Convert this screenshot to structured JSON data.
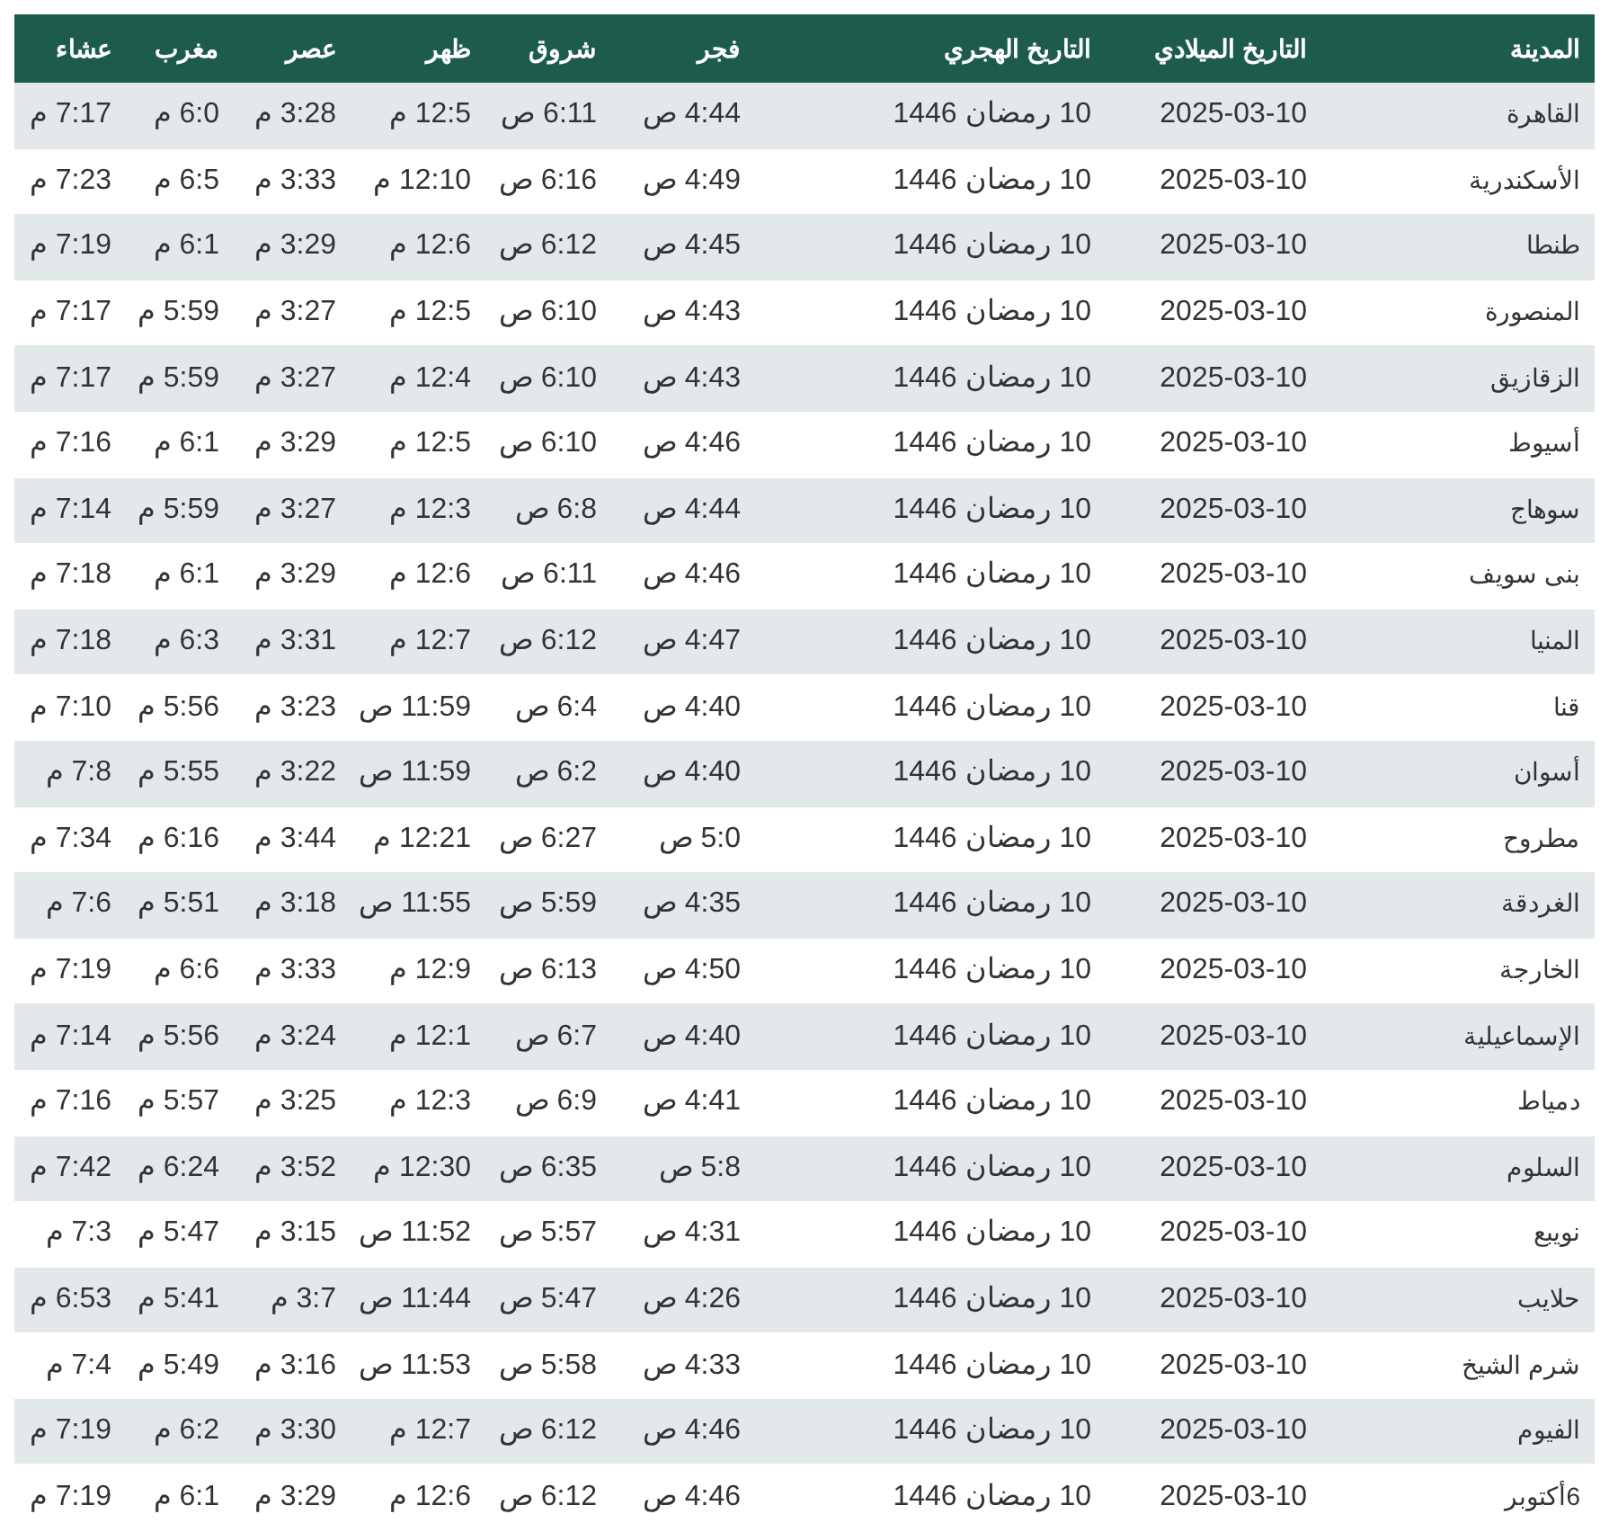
{
  "table": {
    "columns": [
      "المدينة",
      "التاريخ الميلادي",
      "التاريخ الهجري",
      "فجر",
      "شروق",
      "ظهر",
      "عصر",
      "مغرب",
      "عشاء"
    ],
    "rows": [
      [
        "القاهرة",
        "2025-03-10",
        "10 رمضان 1446",
        "4:44 ص",
        "6:11 ص",
        "12:5 م",
        "3:28 م",
        "6:0 م",
        "7:17 م"
      ],
      [
        "الأسكندرية",
        "2025-03-10",
        "10 رمضان 1446",
        "4:49 ص",
        "6:16 ص",
        "12:10 م",
        "3:33 م",
        "6:5 م",
        "7:23 م"
      ],
      [
        "طنطا",
        "2025-03-10",
        "10 رمضان 1446",
        "4:45 ص",
        "6:12 ص",
        "12:6 م",
        "3:29 م",
        "6:1 م",
        "7:19 م"
      ],
      [
        "المنصورة",
        "2025-03-10",
        "10 رمضان 1446",
        "4:43 ص",
        "6:10 ص",
        "12:5 م",
        "3:27 م",
        "5:59 م",
        "7:17 م"
      ],
      [
        "الزقازيق",
        "2025-03-10",
        "10 رمضان 1446",
        "4:43 ص",
        "6:10 ص",
        "12:4 م",
        "3:27 م",
        "5:59 م",
        "7:17 م"
      ],
      [
        "أسيوط",
        "2025-03-10",
        "10 رمضان 1446",
        "4:46 ص",
        "6:10 ص",
        "12:5 م",
        "3:29 م",
        "6:1 م",
        "7:16 م"
      ],
      [
        "سوهاج",
        "2025-03-10",
        "10 رمضان 1446",
        "4:44 ص",
        "6:8 ص",
        "12:3 م",
        "3:27 م",
        "5:59 م",
        "7:14 م"
      ],
      [
        "بنى سويف",
        "2025-03-10",
        "10 رمضان 1446",
        "4:46 ص",
        "6:11 ص",
        "12:6 م",
        "3:29 م",
        "6:1 م",
        "7:18 م"
      ],
      [
        "المنيا",
        "2025-03-10",
        "10 رمضان 1446",
        "4:47 ص",
        "6:12 ص",
        "12:7 م",
        "3:31 م",
        "6:3 م",
        "7:18 م"
      ],
      [
        "قنا",
        "2025-03-10",
        "10 رمضان 1446",
        "4:40 ص",
        "6:4 ص",
        "11:59 ص",
        "3:23 م",
        "5:56 م",
        "7:10 م"
      ],
      [
        "أسوان",
        "2025-03-10",
        "10 رمضان 1446",
        "4:40 ص",
        "6:2 ص",
        "11:59 ص",
        "3:22 م",
        "5:55 م",
        "7:8 م"
      ],
      [
        "مطروح",
        "2025-03-10",
        "10 رمضان 1446",
        "5:0 ص",
        "6:27 ص",
        "12:21 م",
        "3:44 م",
        "6:16 م",
        "7:34 م"
      ],
      [
        "الغردقة",
        "2025-03-10",
        "10 رمضان 1446",
        "4:35 ص",
        "5:59 ص",
        "11:55 ص",
        "3:18 م",
        "5:51 م",
        "7:6 م"
      ],
      [
        "الخارجة",
        "2025-03-10",
        "10 رمضان 1446",
        "4:50 ص",
        "6:13 ص",
        "12:9 م",
        "3:33 م",
        "6:6 م",
        "7:19 م"
      ],
      [
        "الإسماعيلية",
        "2025-03-10",
        "10 رمضان 1446",
        "4:40 ص",
        "6:7 ص",
        "12:1 م",
        "3:24 م",
        "5:56 م",
        "7:14 م"
      ],
      [
        "دمياط",
        "2025-03-10",
        "10 رمضان 1446",
        "4:41 ص",
        "6:9 ص",
        "12:3 م",
        "3:25 م",
        "5:57 م",
        "7:16 م"
      ],
      [
        "السلوم",
        "2025-03-10",
        "10 رمضان 1446",
        "5:8 ص",
        "6:35 ص",
        "12:30 م",
        "3:52 م",
        "6:24 م",
        "7:42 م"
      ],
      [
        "نويبع",
        "2025-03-10",
        "10 رمضان 1446",
        "4:31 ص",
        "5:57 ص",
        "11:52 ص",
        "3:15 م",
        "5:47 م",
        "7:3 م"
      ],
      [
        "حلايب",
        "2025-03-10",
        "10 رمضان 1446",
        "4:26 ص",
        "5:47 ص",
        "11:44 ص",
        "3:7 م",
        "5:41 م",
        "6:53 م"
      ],
      [
        "شرم الشيخ",
        "2025-03-10",
        "10 رمضان 1446",
        "4:33 ص",
        "5:58 ص",
        "11:53 ص",
        "3:16 م",
        "5:49 م",
        "7:4 م"
      ],
      [
        "الفيوم",
        "2025-03-10",
        "10 رمضان 1446",
        "4:46 ص",
        "6:12 ص",
        "12:7 م",
        "3:30 م",
        "6:2 م",
        "7:19 م"
      ],
      [
        "6أكتوبر",
        "2025-03-10",
        "10 رمضان 1446",
        "4:46 ص",
        "6:12 ص",
        "12:6 م",
        "3:29 م",
        "6:1 م",
        "7:19 م"
      ]
    ]
  }
}
